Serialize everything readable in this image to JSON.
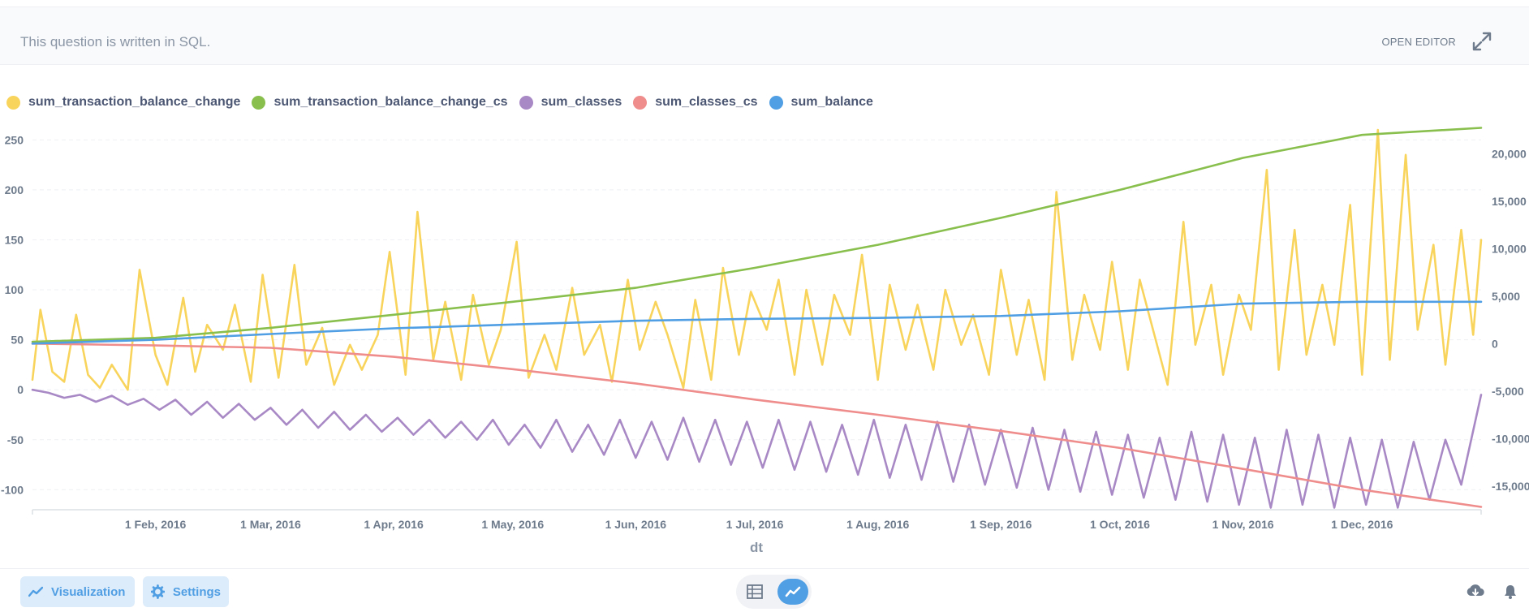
{
  "question_bar": {
    "text": "This question is written in SQL.",
    "open_editor_label": "OPEN EDITOR"
  },
  "legend": [
    {
      "label": "sum_transaction_balance_change",
      "color": "#f9d45c"
    },
    {
      "label": "sum_transaction_balance_change_cs",
      "color": "#88bf4d"
    },
    {
      "label": "sum_classes",
      "color": "#a989c5"
    },
    {
      "label": "sum_classes_cs",
      "color": "#ef8c8c"
    },
    {
      "label": "sum_balance",
      "color": "#509ee3"
    }
  ],
  "footer": {
    "visualization_label": "Visualization",
    "settings_label": "Settings",
    "icons": [
      "visualization-icon",
      "gear-icon",
      "table-icon",
      "line-chart-icon",
      "download-icon",
      "bell-icon"
    ]
  },
  "chart_data": {
    "type": "line",
    "xlabel": "dt",
    "x_ticks": [
      "1 Feb, 2016",
      "1 Mar, 2016",
      "1 Apr, 2016",
      "1 May, 2016",
      "1 Jun, 2016",
      "1 Jul, 2016",
      "1 Aug, 2016",
      "1 Sep, 2016",
      "1 Oct, 2016",
      "1 Nov, 2016",
      "1 Dec, 2016"
    ],
    "x_range": [
      "2016-01-01",
      "2016-12-31"
    ],
    "left_axis": {
      "ylim": [
        -120,
        260
      ],
      "ticks": [
        "250",
        "200",
        "150",
        "100",
        "50",
        "0",
        "-50",
        "-100"
      ],
      "tick_values": [
        250,
        200,
        150,
        100,
        50,
        0,
        -50,
        -100
      ]
    },
    "right_axis": {
      "ylim": [
        -17500,
        22500
      ],
      "ticks": [
        "20,000",
        "15,000",
        "10,000",
        "5,000",
        "0",
        "-5,000",
        "-10,000",
        "-15,000"
      ],
      "tick_values": [
        20000,
        15000,
        10000,
        5000,
        0,
        -5000,
        -10000,
        -15000
      ]
    },
    "grid": true,
    "series": [
      {
        "name": "sum_transaction_balance_change",
        "axis": "left",
        "color": "#f9d45c",
        "x": [
          "2016-01-01",
          "2016-01-03",
          "2016-01-06",
          "2016-01-09",
          "2016-01-12",
          "2016-01-15",
          "2016-01-18",
          "2016-01-21",
          "2016-01-25",
          "2016-01-28",
          "2016-02-01",
          "2016-02-04",
          "2016-02-08",
          "2016-02-11",
          "2016-02-14",
          "2016-02-18",
          "2016-02-21",
          "2016-02-25",
          "2016-02-28",
          "2016-03-03",
          "2016-03-07",
          "2016-03-10",
          "2016-03-14",
          "2016-03-17",
          "2016-03-21",
          "2016-03-24",
          "2016-03-28",
          "2016-03-31",
          "2016-04-04",
          "2016-04-07",
          "2016-04-11",
          "2016-04-14",
          "2016-04-18",
          "2016-04-21",
          "2016-04-25",
          "2016-04-28",
          "2016-05-02",
          "2016-05-05",
          "2016-05-09",
          "2016-05-12",
          "2016-05-16",
          "2016-05-19",
          "2016-05-23",
          "2016-05-26",
          "2016-05-30",
          "2016-06-02",
          "2016-06-06",
          "2016-06-09",
          "2016-06-13",
          "2016-06-16",
          "2016-06-20",
          "2016-06-23",
          "2016-06-27",
          "2016-06-30",
          "2016-07-04",
          "2016-07-07",
          "2016-07-11",
          "2016-07-14",
          "2016-07-18",
          "2016-07-21",
          "2016-07-25",
          "2016-07-28",
          "2016-08-01",
          "2016-08-04",
          "2016-08-08",
          "2016-08-11",
          "2016-08-15",
          "2016-08-18",
          "2016-08-22",
          "2016-08-25",
          "2016-08-29",
          "2016-09-01",
          "2016-09-05",
          "2016-09-08",
          "2016-09-12",
          "2016-09-15",
          "2016-09-19",
          "2016-09-22",
          "2016-09-26",
          "2016-09-29",
          "2016-10-03",
          "2016-10-06",
          "2016-10-10",
          "2016-10-13",
          "2016-10-17",
          "2016-10-20",
          "2016-10-24",
          "2016-10-27",
          "2016-10-31",
          "2016-11-03",
          "2016-11-07",
          "2016-11-10",
          "2016-11-14",
          "2016-11-17",
          "2016-11-21",
          "2016-11-24",
          "2016-11-28",
          "2016-12-01",
          "2016-12-05",
          "2016-12-08",
          "2016-12-12",
          "2016-12-15",
          "2016-12-19",
          "2016-12-22",
          "2016-12-26",
          "2016-12-29",
          "2016-12-31"
        ],
        "y": [
          10,
          80,
          18,
          8,
          75,
          15,
          2,
          25,
          0,
          120,
          35,
          5,
          92,
          18,
          65,
          40,
          85,
          8,
          115,
          12,
          125,
          25,
          62,
          5,
          45,
          20,
          55,
          138,
          15,
          178,
          30,
          88,
          10,
          95,
          25,
          60,
          148,
          12,
          55,
          20,
          102,
          35,
          65,
          8,
          110,
          40,
          88,
          55,
          2,
          90,
          10,
          122,
          35,
          98,
          60,
          110,
          15,
          100,
          25,
          95,
          55,
          135,
          10,
          105,
          40,
          85,
          20,
          100,
          45,
          75,
          15,
          120,
          35,
          90,
          10,
          198,
          30,
          95,
          40,
          128,
          20,
          110,
          50,
          5,
          168,
          45,
          105,
          15,
          95,
          60,
          220,
          20,
          160,
          35,
          105,
          45,
          185,
          15,
          260,
          30,
          235,
          60,
          145,
          25,
          160,
          55,
          150
        ],
        "sampled": true
      },
      {
        "name": "sum_transaction_balance_change_cs",
        "axis": "left",
        "color": "#88bf4d",
        "x": [
          "2016-01-01",
          "2016-02-01",
          "2016-03-01",
          "2016-04-01",
          "2016-05-01",
          "2016-06-01",
          "2016-07-01",
          "2016-08-01",
          "2016-09-01",
          "2016-10-01",
          "2016-11-01",
          "2016-12-01",
          "2016-12-31"
        ],
        "y": [
          48,
          52,
          62,
          75,
          88,
          102,
          122,
          145,
          172,
          200,
          232,
          255,
          262
        ]
      },
      {
        "name": "sum_classes",
        "axis": "left",
        "color": "#a989c5",
        "x": [
          "2016-01-01",
          "2016-01-05",
          "2016-01-09",
          "2016-01-13",
          "2016-01-17",
          "2016-01-21",
          "2016-01-25",
          "2016-01-29",
          "2016-02-02",
          "2016-02-06",
          "2016-02-10",
          "2016-02-14",
          "2016-02-18",
          "2016-02-22",
          "2016-02-26",
          "2016-03-01",
          "2016-03-05",
          "2016-03-09",
          "2016-03-13",
          "2016-03-17",
          "2016-03-21",
          "2016-03-25",
          "2016-03-29",
          "2016-04-02",
          "2016-04-06",
          "2016-04-10",
          "2016-04-14",
          "2016-04-18",
          "2016-04-22",
          "2016-04-26",
          "2016-04-30",
          "2016-05-04",
          "2016-05-08",
          "2016-05-12",
          "2016-05-16",
          "2016-05-20",
          "2016-05-24",
          "2016-05-28",
          "2016-06-01",
          "2016-06-05",
          "2016-06-09",
          "2016-06-13",
          "2016-06-17",
          "2016-06-21",
          "2016-06-25",
          "2016-06-29",
          "2016-07-03",
          "2016-07-07",
          "2016-07-11",
          "2016-07-15",
          "2016-07-19",
          "2016-07-23",
          "2016-07-27",
          "2016-07-31",
          "2016-08-04",
          "2016-08-08",
          "2016-08-12",
          "2016-08-16",
          "2016-08-20",
          "2016-08-24",
          "2016-08-28",
          "2016-09-01",
          "2016-09-05",
          "2016-09-09",
          "2016-09-13",
          "2016-09-17",
          "2016-09-21",
          "2016-09-25",
          "2016-09-29",
          "2016-10-03",
          "2016-10-07",
          "2016-10-11",
          "2016-10-15",
          "2016-10-19",
          "2016-10-23",
          "2016-10-27",
          "2016-10-31",
          "2016-11-04",
          "2016-11-08",
          "2016-11-12",
          "2016-11-16",
          "2016-11-20",
          "2016-11-24",
          "2016-11-28",
          "2016-12-02",
          "2016-12-06",
          "2016-12-10",
          "2016-12-14",
          "2016-12-18",
          "2016-12-22",
          "2016-12-26",
          "2016-12-31"
        ],
        "y": [
          0,
          -3,
          -8,
          -5,
          -12,
          -6,
          -15,
          -9,
          -20,
          -10,
          -25,
          -12,
          -28,
          -14,
          -30,
          -18,
          -35,
          -20,
          -38,
          -22,
          -40,
          -25,
          -42,
          -28,
          -45,
          -30,
          -48,
          -32,
          -50,
          -30,
          -55,
          -35,
          -58,
          -30,
          -62,
          -35,
          -65,
          -30,
          -68,
          -32,
          -70,
          -28,
          -72,
          -30,
          -75,
          -32,
          -78,
          -30,
          -80,
          -32,
          -82,
          -35,
          -85,
          -30,
          -88,
          -35,
          -90,
          -32,
          -92,
          -35,
          -95,
          -40,
          -98,
          -38,
          -100,
          -40,
          -102,
          -42,
          -105,
          -45,
          -108,
          -48,
          -110,
          -42,
          -112,
          -45,
          -115,
          -48,
          -118,
          -40,
          -115,
          -45,
          -118,
          -48,
          -115,
          -50,
          -118,
          -52,
          -110,
          -50,
          -95,
          -5
        ]
      },
      {
        "name": "sum_classes_cs",
        "axis": "right",
        "color": "#ef8c8c",
        "x": [
          "2016-01-01",
          "2016-02-01",
          "2016-03-01",
          "2016-04-01",
          "2016-05-01",
          "2016-06-01",
          "2016-07-01",
          "2016-08-01",
          "2016-09-01",
          "2016-10-01",
          "2016-11-01",
          "2016-12-01",
          "2016-12-31"
        ],
        "y": [
          0,
          -200,
          -450,
          -1400,
          -2700,
          -4200,
          -5900,
          -7500,
          -9200,
          -11000,
          -13200,
          -15400,
          -17200
        ]
      },
      {
        "name": "sum_balance",
        "axis": "right",
        "color": "#509ee3",
        "x": [
          "2016-01-01",
          "2016-02-01",
          "2016-03-01",
          "2016-04-01",
          "2016-05-01",
          "2016-06-01",
          "2016-07-01",
          "2016-08-01",
          "2016-09-01",
          "2016-10-01",
          "2016-11-01",
          "2016-12-01",
          "2016-12-31"
        ],
        "y": [
          0,
          400,
          1000,
          1600,
          2000,
          2400,
          2600,
          2700,
          2900,
          3400,
          4200,
          4400,
          4400
        ]
      }
    ]
  }
}
